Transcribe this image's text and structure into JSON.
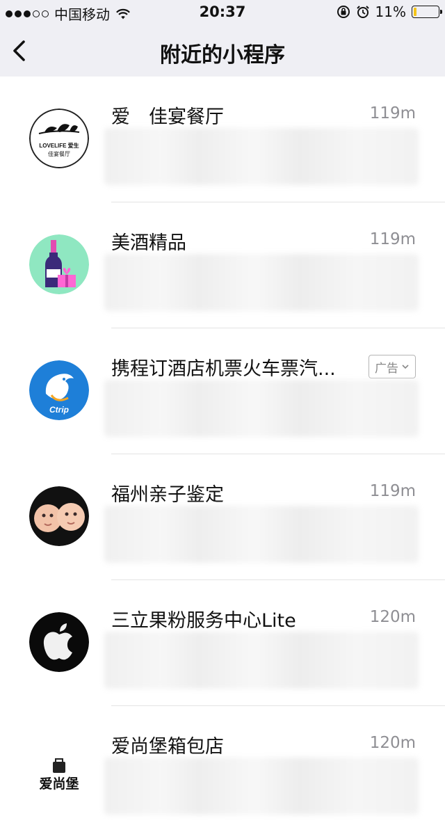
{
  "status_bar": {
    "carrier": "中国移动",
    "time": "20:37",
    "battery": "11%",
    "battery_level": 0.11
  },
  "nav": {
    "title": "附近的小程序",
    "back_icon": "chevron-left-icon"
  },
  "items": [
    {
      "name": "爱　佳宴餐厅",
      "distance": "119m",
      "icon": "lovelife-logo"
    },
    {
      "name": "美酒精品",
      "distance": "119m",
      "icon": "wine-gift-logo"
    },
    {
      "name": "携程订酒店机票火车票汽...",
      "badge": "广告",
      "icon": "ctrip-logo"
    },
    {
      "name": "福州亲子鉴定",
      "distance": "119m",
      "icon": "babies-logo"
    },
    {
      "name": "三立果粉服务中心Lite",
      "distance": "120m",
      "icon": "apple-logo"
    },
    {
      "name": "爱尚堡箱包店",
      "distance": "120m",
      "icon": "aishangbao-logo"
    }
  ],
  "logos": {
    "lovelife_line1": "LOVELIFE 爱生",
    "lovelife_line2": "佳宴餐厅",
    "ctrip": "Ctrip",
    "aishangbao": "爱尚堡"
  }
}
